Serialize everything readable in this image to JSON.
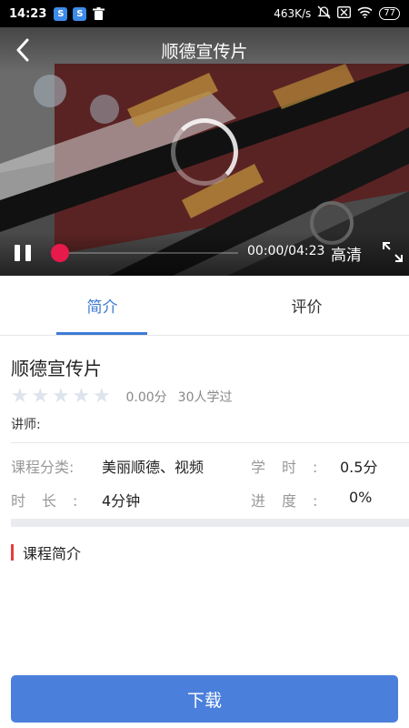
{
  "status_bar": {
    "time": "14:23",
    "network_speed": "463K/s",
    "battery": "77",
    "icons": [
      "app-notification-icon",
      "app-notification-icon",
      "trash-icon",
      "alarm-off-icon",
      "sim-off-icon",
      "wifi-icon",
      "battery-icon"
    ]
  },
  "video": {
    "title": "顺德宣传片",
    "time": "00:00/04:23",
    "quality": "高清",
    "progress": 0
  },
  "tabs": [
    {
      "label": "简介",
      "active": true
    },
    {
      "label": "评价",
      "active": false
    }
  ],
  "course": {
    "title": "顺德宣传片",
    "stars": 0,
    "star_max": 5,
    "score": "0.00分",
    "learners": "30人学过",
    "teacher_label": "讲师:",
    "category_label": "课程分类:",
    "category_value": "美丽顺德、视频",
    "credit_label": "学时:",
    "credit_value": "0.5分",
    "duration_label": "时长:",
    "duration_value": "4分钟",
    "progress_label": "进度:",
    "progress_value": "0%"
  },
  "section": {
    "intro_heading": "课程简介"
  },
  "download_button": "下载",
  "colors": {
    "accent": "#3e7bd6",
    "button": "#4b7fdc",
    "seek_dot": "#e8194b",
    "section_mark": "#e53e3e"
  }
}
